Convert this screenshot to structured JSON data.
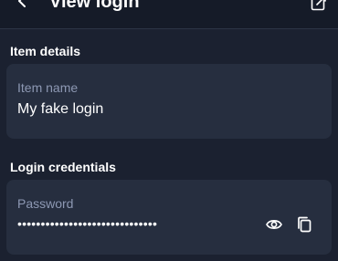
{
  "header": {
    "title": "View login",
    "back_icon": "chevron-left-icon",
    "edit_icon": "edit-external-icon"
  },
  "item_details": {
    "section_title": "Item details",
    "name_label": "Item name",
    "name_value": "My fake login"
  },
  "login_credentials": {
    "section_title": "Login credentials",
    "password_label": "Password",
    "password_masked": "••••••••••••••••••••••••••••••",
    "show_icon": "eye-icon",
    "copy_icon": "copy-icon"
  },
  "colors": {
    "background": "#1b2130",
    "card": "#262e3f",
    "label": "#8d98b3",
    "text": "#ffffff"
  }
}
